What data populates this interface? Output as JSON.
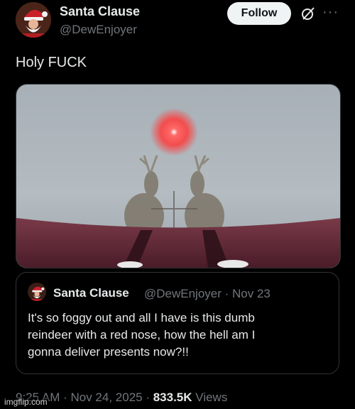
{
  "tweet": {
    "author_name": "Santa Clause",
    "author_handle": "@DewEnjoyer",
    "follow_label": "Follow",
    "more_label": "···",
    "text": "Holy FUCK",
    "timestamp": "9:25 AM · Nov 24, 2025",
    "separator": " · ",
    "views_count": "833.5K",
    "views_label": "Views"
  },
  "quoted": {
    "author_name": "Santa Clause",
    "author_meta": "@DewEnjoyer · Nov 23",
    "text_lines": [
      "It's so foggy out and all I have is this dumb",
      "reindeer with a red nose, how the hell am I",
      "gonna deliver presents now?!!"
    ]
  },
  "watermark": "imgflip.com",
  "colors": {
    "background": "#000000",
    "text_primary": "#e7e9ea",
    "text_secondary": "#71767b",
    "follow_bg": "#eff3f4",
    "border": "#2f3336",
    "nose_red": "#ff3b3b"
  },
  "icons": {
    "grok": "grok-slash-icon",
    "more": "more-icon"
  }
}
